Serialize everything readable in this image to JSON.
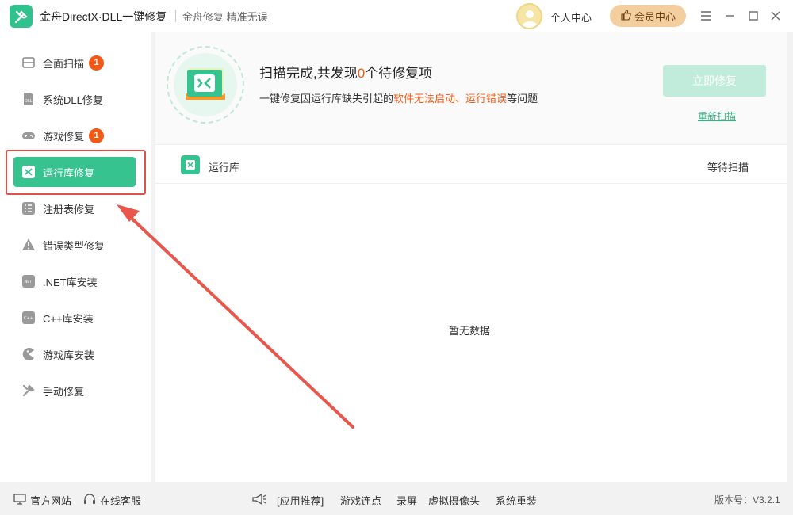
{
  "titlebar": {
    "app_title": "金舟DirectX·DLL一键修复",
    "subtitle": "金舟修复 精准无误",
    "personal_center": "个人中心",
    "vip_center": "会员中心"
  },
  "sidebar": {
    "items": [
      {
        "label": "全面扫描",
        "icon": "scan-icon",
        "badge": "1"
      },
      {
        "label": "系统DLL修复",
        "icon": "dll-icon",
        "badge": ""
      },
      {
        "label": "游戏修复",
        "icon": "gamepad-icon",
        "badge": "1"
      },
      {
        "label": "运行库修复",
        "icon": "runtime-icon",
        "badge": "",
        "active": true
      },
      {
        "label": "注册表修复",
        "icon": "registry-icon",
        "badge": ""
      },
      {
        "label": "错误类型修复",
        "icon": "warning-icon",
        "badge": ""
      },
      {
        "label": ".NET库安装",
        "icon": "dotnet-icon",
        "badge": ""
      },
      {
        "label": "C++库安装",
        "icon": "cpp-icon",
        "badge": ""
      },
      {
        "label": "游戏库安装",
        "icon": "pacman-icon",
        "badge": ""
      },
      {
        "label": "手动修复",
        "icon": "wrench-icon",
        "badge": ""
      }
    ]
  },
  "main": {
    "scan_title_prefix": "扫描完成,共发现",
    "scan_count": "0",
    "scan_title_suffix": "个待修复项",
    "desc_prefix": "一键修复因运行库缺失引起的",
    "desc_highlight1": "软件无法启动",
    "desc_sep": "、",
    "desc_highlight2": "运行错误",
    "desc_suffix": "等问题",
    "repair_button": "立即修复",
    "rescan_link": "重新扫描",
    "row_label": "运行库",
    "row_status": "等待扫描",
    "empty_text": "暂无数据"
  },
  "footer": {
    "official_site": "官方网站",
    "online_service": "在线客服",
    "app_recommend": "[应用推荐]",
    "links": [
      "游戏连点",
      "录屏",
      "虚拟摄像头",
      "系统重装"
    ],
    "version": "版本号：V3.2.1"
  },
  "colors": {
    "accent": "#36c38f",
    "badge": "#f05a16",
    "highlight_box": "#e05248",
    "vip": "#f3cfa0"
  }
}
